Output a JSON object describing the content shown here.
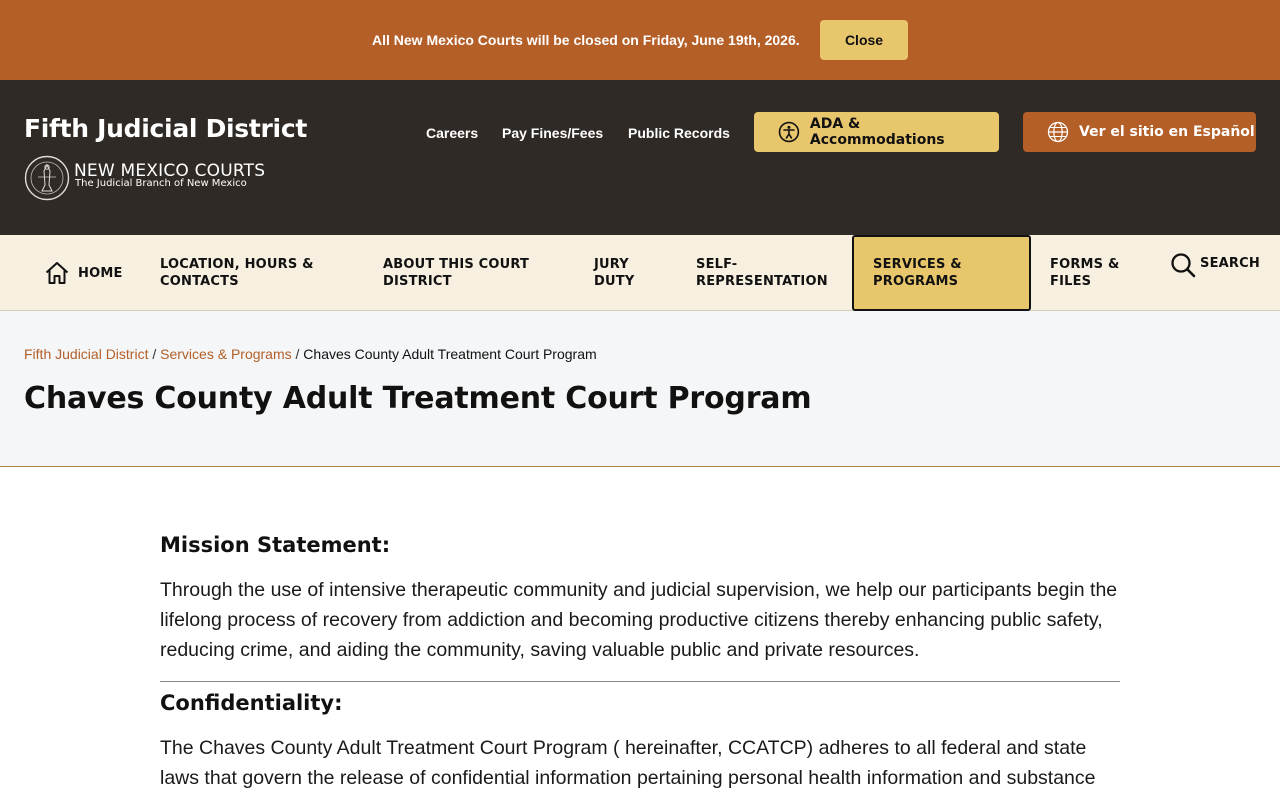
{
  "alert": {
    "message": "All New Mexico Courts will be closed on Friday, June 19th, 2026.",
    "close_label": "Close"
  },
  "header": {
    "site_title": "Fifth Judicial District",
    "brand_name": "NEW MEXICO COURTS",
    "brand_subtitle": "The Judicial Branch of New Mexico",
    "links": [
      "Careers",
      "Pay Fines/Fees",
      "Public Records"
    ],
    "ada_label": "ADA & Accommodations",
    "lang_label": "Ver el sitio en Español"
  },
  "nav": {
    "home": "HOME",
    "location_1": "LOCATION, HOURS &",
    "location_2": "CONTACTS",
    "about_1": "ABOUT THIS COURT",
    "about_2": "DISTRICT",
    "jury_1": "JURY",
    "jury_2": "DUTY",
    "self_1": "SELF-",
    "self_2": "REPRESENTATION",
    "services_1": "SERVICES &",
    "services_2": "PROGRAMS",
    "forms_1": "FORMS &",
    "forms_2": "FILES",
    "search": "SEARCH"
  },
  "breadcrumb": {
    "home": "Fifth Judicial District",
    "section": "Services & Programs",
    "current": "Chaves County Adult Treatment Court Program"
  },
  "page_title": "Chaves County Adult Treatment Court Program",
  "content": {
    "mission_heading": "Mission Statement:",
    "mission_text": "Through the use of intensive therapeutic community and judicial supervision, we help our participants begin the lifelong process of recovery from addiction and becoming productive citizens thereby enhancing public safety, reducing crime, and aiding the community, saving valuable public and private resources.",
    "conf_heading": "Confidentiality:",
    "conf_text": "The Chaves County Adult Treatment Court Program ( hereinafter, CCATCP) adheres to all federal and state laws that govern the release of confidential information pertaining personal health information and substance"
  },
  "colors": {
    "accent_orange": "#b45f28",
    "accent_gold": "#e8c66c",
    "header_dark": "#302a26",
    "nav_bg": "#f7f0e1"
  }
}
